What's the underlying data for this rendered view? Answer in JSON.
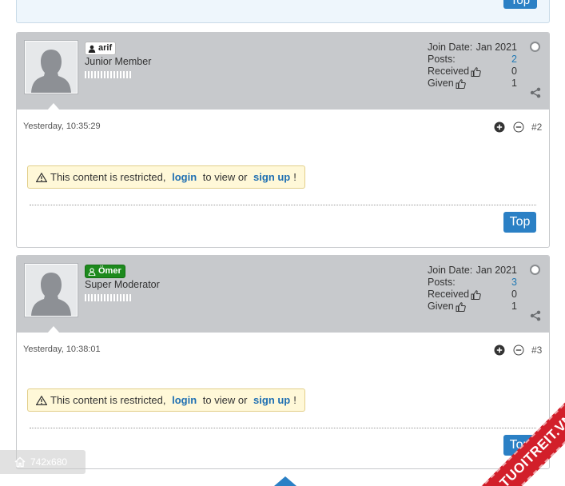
{
  "top_label": "Top",
  "posts": [
    {
      "username": "arif",
      "user_title": "Junior Member",
      "username_style": "member",
      "join_label": "Join Date:",
      "join_value": "Jan 2021",
      "posts_label": "Posts:",
      "posts_value": "2",
      "received_label": "Received",
      "received_value": "0",
      "given_label": "Given",
      "given_value": "1",
      "date": "Yesterday, 10:35:29",
      "post_number": "#2",
      "restricted": {
        "prefix": "This content is restricted, ",
        "login": "login",
        "middle": " to view or ",
        "signup": "sign up",
        "suffix": "!"
      }
    },
    {
      "username": "Ömer",
      "user_title": "Super Moderator",
      "username_style": "mod",
      "join_label": "Join Date:",
      "join_value": "Jan 2021",
      "posts_label": "Posts:",
      "posts_value": "3",
      "received_label": "Received",
      "received_value": "0",
      "given_label": "Given",
      "given_value": "1",
      "date": "Yesterday, 10:38:01",
      "post_number": "#3",
      "restricted": {
        "prefix": "This content is restricted, ",
        "login": "login",
        "middle": " to view or ",
        "signup": "sign up",
        "suffix": "!"
      }
    }
  ],
  "image_size_badge": "742x680",
  "watermark_text": "TUOITREIT.VN",
  "colors": {
    "header_bg": "#c7c9cc",
    "accent": "#2b80c5",
    "link": "#1f6fb2",
    "moderator": "#1d8a1d",
    "notice_bg": "#fff8d8",
    "ribbon": "#d21f2a"
  },
  "icons": [
    "user-icon",
    "thumbs-up-icon",
    "share-icon",
    "plus-circle-icon",
    "minus-circle-icon",
    "warning-icon",
    "online-status-icon",
    "home-icon"
  ]
}
